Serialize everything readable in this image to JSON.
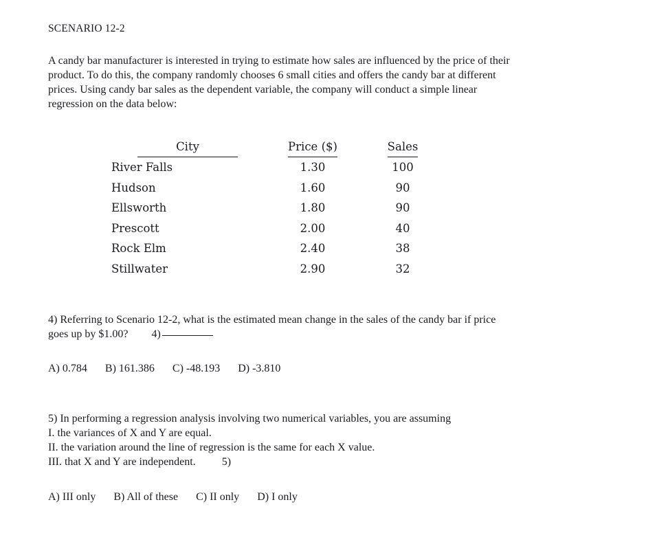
{
  "document": {
    "scenario_heading": "SCENARIO 12-2",
    "intro_lines": [
      "A candy bar manufacturer is interested in trying to estimate how sales are influenced by the price of their",
      "product. To do this, the company randomly chooses 6 small cities and offers the candy bar at different",
      "prices. Using candy bar sales as the dependent variable, the company will conduct a simple linear",
      "regression on the data below:"
    ]
  },
  "table": {
    "headers": {
      "city": "City",
      "price": "Price ($)",
      "sales": "Sales"
    },
    "rows": [
      {
        "city": "River Falls",
        "price": "1.30",
        "sales": "100"
      },
      {
        "city": "Hudson",
        "price": "1.60",
        "sales": "90"
      },
      {
        "city": "Ellsworth",
        "price": "1.80",
        "sales": "90"
      },
      {
        "city": "Prescott",
        "price": "2.00",
        "sales": "40"
      },
      {
        "city": "Rock Elm",
        "price": "2.40",
        "sales": "38"
      },
      {
        "city": "Stillwater",
        "price": "2.90",
        "sales": "32"
      }
    ]
  },
  "questions": [
    {
      "number": "4)",
      "lines": [
        "4) Referring to Scenario 12-2, what is the estimated mean change in the sales of the candy bar if price",
        "goes up by $1.00?"
      ],
      "answer_label": "4)",
      "choices": [
        "A) 0.784",
        "B) 161.386",
        "C) -48.193",
        "D) -3.810"
      ]
    },
    {
      "number": "5)",
      "lines": [
        "5) In performing a regression analysis involving two numerical variables, you are assuming",
        "I. the variances of X and Y are equal.",
        "II. the variation around the line of regression is the same for each X value.",
        "III. that X and Y are independent."
      ],
      "answer_label": "5)",
      "choices": [
        "A) III only",
        "B) All of these",
        "C) II only",
        "D) I only"
      ]
    }
  ]
}
